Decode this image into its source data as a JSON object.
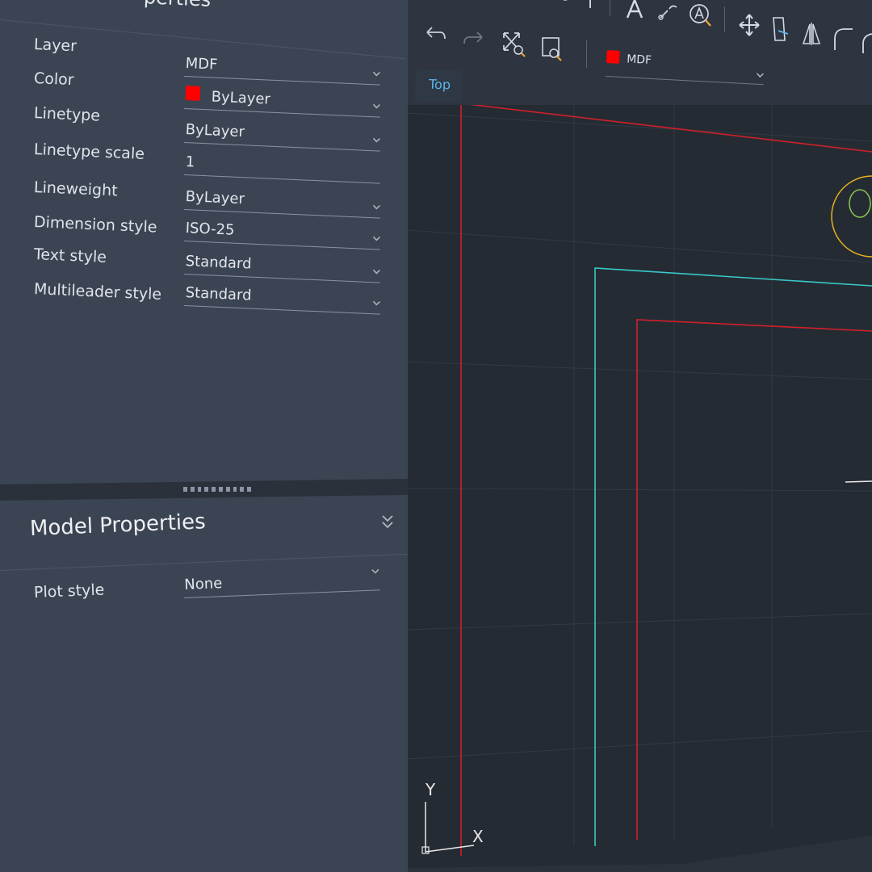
{
  "panel": {
    "section_title": "perties",
    "general_properties": [
      {
        "label": "Layer",
        "value": "MDF"
      },
      {
        "label": "Color",
        "value": "ByLayer",
        "swatch": "#ff0000"
      },
      {
        "label": "Linetype",
        "value": "ByLayer"
      },
      {
        "label": "Linetype scale",
        "value": "1"
      },
      {
        "label": "Lineweight",
        "value": "ByLayer"
      },
      {
        "label": "Dimension style",
        "value": "ISO-25"
      },
      {
        "label": "Text style",
        "value": "Standard"
      },
      {
        "label": "Multileader style",
        "value": "Standard"
      }
    ],
    "model_properties": {
      "title": "Model Properties",
      "rows": [
        {
          "label": "Plot style",
          "value": "None"
        }
      ]
    }
  },
  "toolbar": {
    "icons": [
      "undo-icon",
      "redo-icon",
      "zoom-extents-icon",
      "zoom-window-icon",
      "text-icon",
      "leader-icon",
      "find-text-icon",
      "move-icon",
      "mirror-icon",
      "align-icon",
      "fillet-icon"
    ],
    "current_layer": {
      "name": "MDF",
      "color": "#ff0000"
    }
  },
  "viewport": {
    "view_name": "Top",
    "ucs": {
      "x_label": "X",
      "y_label": "Y"
    }
  },
  "colors": {
    "panel_bg": "#3b4453",
    "canvas_bg": "#252b33",
    "red_line": "#d0202a",
    "cyan_line": "#38c8c8",
    "yellow_circle": "#e6b020",
    "green_circle": "#8cc850",
    "view_tab_text": "#5ab8ea"
  }
}
